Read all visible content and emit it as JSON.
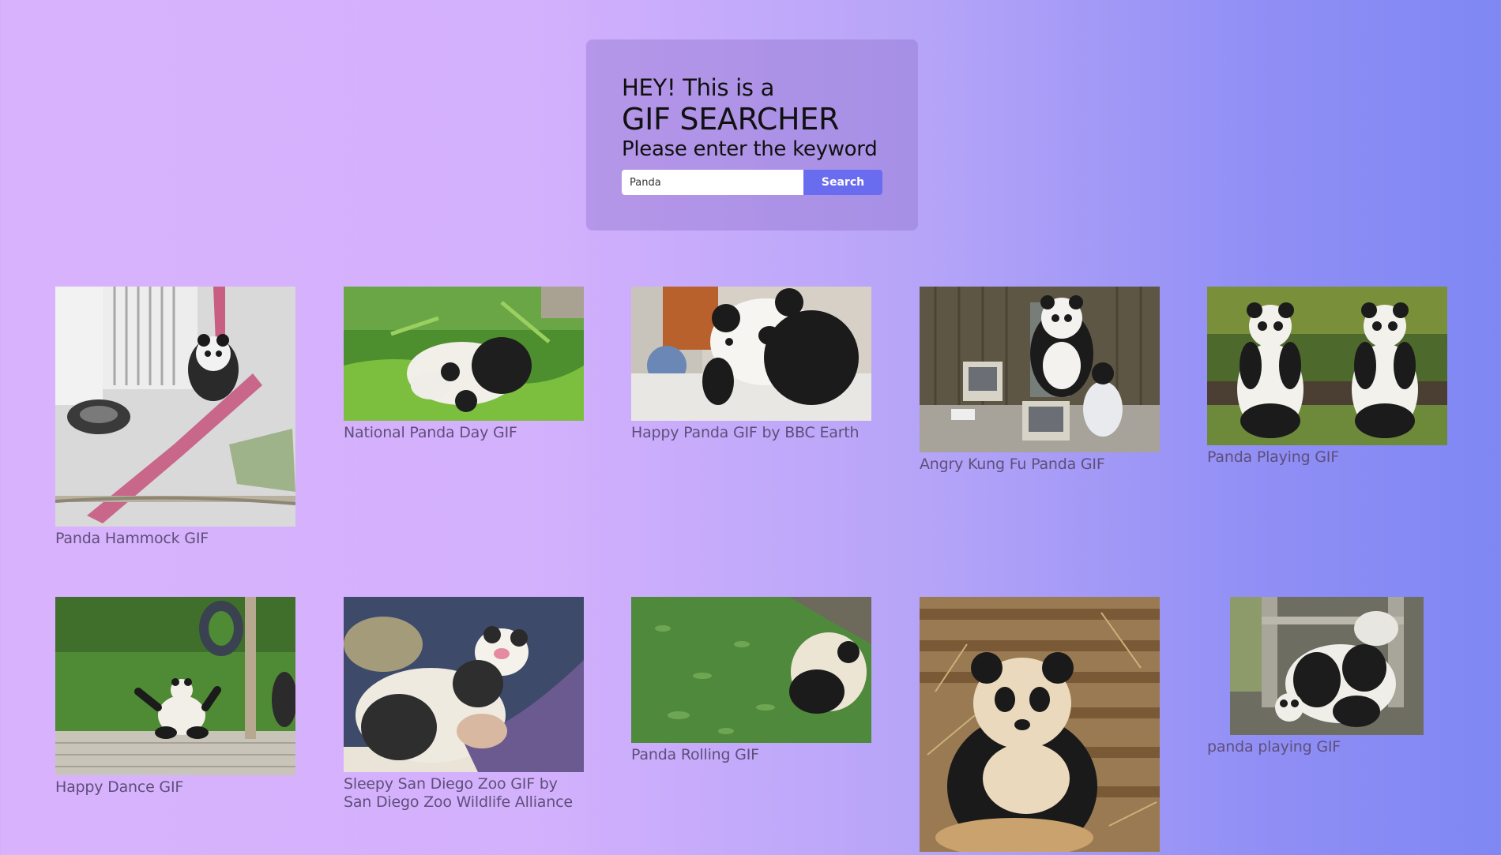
{
  "header": {
    "line1": "HEY! This is a",
    "line2": "GIF SEARCHER",
    "line3": "Please enter the keyword"
  },
  "search": {
    "value": "Panda",
    "button_label": "Search"
  },
  "results": [
    {
      "title": "Panda Hammock GIF"
    },
    {
      "title": "National Panda Day GIF"
    },
    {
      "title": "Happy Panda GIF by BBC Earth"
    },
    {
      "title": "Angry Kung Fu Panda GIF"
    },
    {
      "title": "Panda Playing GIF"
    },
    {
      "title": "Happy Dance GIF"
    },
    {
      "title": "Sleepy San Diego Zoo GIF by San Diego Zoo Wildlife Alliance"
    },
    {
      "title": "Panda Rolling GIF"
    },
    {
      "title": ""
    },
    {
      "title": "panda playing GIF"
    }
  ],
  "colors": {
    "accent": "#6a6cf0",
    "gradient_start": "#d8b2fd",
    "gradient_end": "#7f87f3"
  }
}
